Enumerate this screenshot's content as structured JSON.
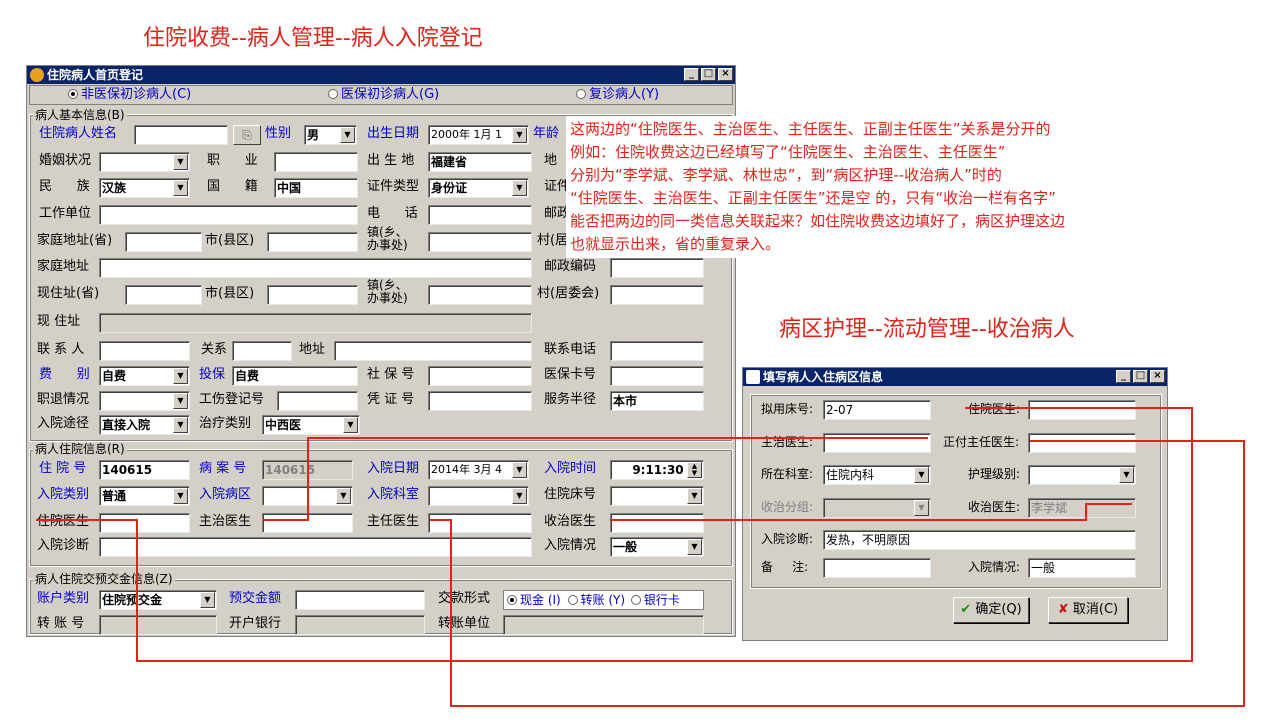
{
  "titles": {
    "left": "住院收费--病人管理--病人入院登记",
    "right": "病区护理--流动管理--收治病人"
  },
  "annotation": [
    "这两边的“住院医生、主治医生、主任医生、正副主任医生”关系是分开的",
    "例如：住院收费这边已经填写了“住院医生、主治医生、主任医生”",
    "分别为“李学斌、李学斌、林世忠”，到“病区护理--收治病人”时的",
    "“住院医生、主治医生、正副主任医生”还是空 的，只有“收治一栏有名字”",
    "能否把两边的同一类信息关联起来？如住院收费这边填好了，病区护理这边",
    "也就显示出来，省的重复录入。"
  ],
  "colors": {
    "annotation_red": "#e2231a",
    "titlebar": "#0a246a",
    "window_face": "#d4d0c8"
  },
  "win1": {
    "title": "住院病人首页登记",
    "radios": [
      "非医保初诊病人(C)",
      "医保初诊病人(G)",
      "复诊病人(Y)"
    ],
    "basic": {
      "group": "病人基本信息(B)",
      "name_lbl": "住院病人姓名",
      "sex_lbl": "性别",
      "sex": "男",
      "birth_lbl": "出生日期",
      "birth": "2000年  1月  1",
      "age_lbl": "年龄",
      "marital_lbl": "婚姻状况",
      "job_lbl": "职      业",
      "birthplace_lbl": "出 生 地",
      "birthplace": "福建省",
      "addr_lbl": "地",
      "ethnic_lbl": "民      族",
      "ethnic": "汉族",
      "nation_lbl": "国      籍",
      "nation": "中国",
      "idtype_lbl": "证件类型",
      "idtype": "身份证",
      "idno_lbl": "证件号",
      "work_lbl": "工作单位",
      "phone_lbl": "电      话",
      "zip_lbl": "邮政编码",
      "home_prov_lbl": "家庭地址(省)",
      "city_lbl": "市(县区)",
      "town_lbl": "镇(乡、\n办事处)",
      "village_lbl": "村(居委会)",
      "home_lbl": "家庭地址",
      "zip2_lbl": "邮政编码",
      "cur_prov_lbl": "现住址(省)",
      "city2_lbl": "市(县区)",
      "town2_lbl": "镇(乡、\n办事处)",
      "village2_lbl": "村(居委会)",
      "cur_lbl": "现 住址",
      "contact_lbl": "联 系 人",
      "relation_lbl": "关系",
      "caddr_lbl": "地址",
      "cphone_lbl": "联系电话",
      "fee_lbl": "费      别",
      "fee": "自费",
      "insure_lbl": "投保",
      "insure": "自费",
      "social_lbl": "社 保 号",
      "medcard_lbl": "医保卡号",
      "retire_lbl": "职退情况",
      "injury_lbl": "工伤登记号",
      "voucher_lbl": "凭 证 号",
      "radius_lbl": "服务半径",
      "radius": "本市",
      "route_lbl": "入院途径",
      "route": "直接入院",
      "treat_lbl": "治疗类别",
      "treat": "中西医"
    },
    "inpatient": {
      "group": "病人住院信息(R)",
      "no_lbl": "住 院 号",
      "no": "140615",
      "case_lbl": "病 案 号",
      "case": "140615",
      "date_lbl": "入院日期",
      "date": "2014年  3月  4",
      "time_lbl": "入院时间",
      "time": "9:11:30",
      "type_lbl": "入院类别",
      "type": "普通",
      "ward_lbl": "入院病区",
      "dept_lbl": "入院科室",
      "bed_lbl": "住院床号",
      "resident_lbl": "住院医生",
      "attending_lbl": "主治医生",
      "chief_lbl": "主任医生",
      "admit_lbl": "收治医生",
      "diag_lbl": "入院诊断",
      "cond_lbl": "入院情况",
      "cond": "一般"
    },
    "deposit": {
      "group": "病人住院交预交金信息(Z)",
      "acct_lbl": "账户类别",
      "acct": "住院预交金",
      "amount_lbl": "预交金额",
      "pay_lbl": "交款形式",
      "pay_options": [
        "现金 (I)",
        "转账 (Y)",
        "银行卡"
      ],
      "transfer_lbl": "转 账 号",
      "bank_lbl": "开户银行",
      "tunit_lbl": "转账单位"
    }
  },
  "win2": {
    "title": "填写病人入住病区信息",
    "bed_lbl": "拟用床号:",
    "bed": "2-07",
    "resident_lbl": "住院医生:",
    "attending_lbl": "主治医生:",
    "vice_lbl": "正付主任医生:",
    "dept_lbl": "所在科室:",
    "dept": "住院内科",
    "nurse_lbl": "护理级别:",
    "group_lbl": "收治分组:",
    "admit_lbl": "收治医生:",
    "admit": "李学斌",
    "diag_lbl": "入院诊断:",
    "diag": "发热，不明原因",
    "remark_lbl": "备     注:",
    "cond_lbl": "入院情况:",
    "cond": "一般",
    "ok": "确定(Q)",
    "cancel": "取消(C)"
  }
}
